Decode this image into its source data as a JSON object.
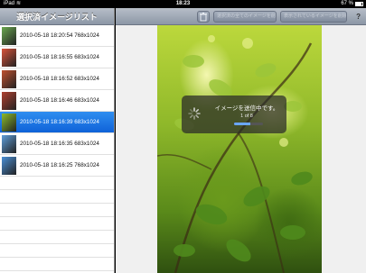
{
  "status_bar": {
    "carrier": "iPad",
    "wifi_icon": "wifi-icon",
    "time": "18:23",
    "battery_percent": "67 %"
  },
  "master": {
    "title": "選択済イメージリスト",
    "items": [
      {
        "label": "2010-05-18 18:20:54 768x1024",
        "thumb_color": "#6aa84f"
      },
      {
        "label": "2010-05-18 18:16:55 683x1024",
        "thumb_color": "#d9533a"
      },
      {
        "label": "2010-05-18 18:16:52 683x1024",
        "thumb_color": "#c0512f"
      },
      {
        "label": "2010-05-18 18:16:46 683x1024",
        "thumb_color": "#b04030"
      },
      {
        "label": "2010-05-18 18:16:39 683x1024",
        "thumb_color": "#8bbb2c",
        "selected": true
      },
      {
        "label": "2010-05-18 18:16:35 683x1024",
        "thumb_color": "#5e9eda"
      },
      {
        "label": "2010-05-18 18:16:25 768x1024",
        "thumb_color": "#4a8fd6"
      }
    ]
  },
  "toolbar": {
    "trash_icon": "trash-icon",
    "btn_remove_all": "選択済の全てのイメージを削除",
    "btn_remove_shown": "表示されているイメージを削除",
    "help": "?"
  },
  "hud": {
    "message": "イメージを送信中です。",
    "count": "1 of 8",
    "progress": 0.55,
    "spinner_icon": "spinner-icon"
  }
}
